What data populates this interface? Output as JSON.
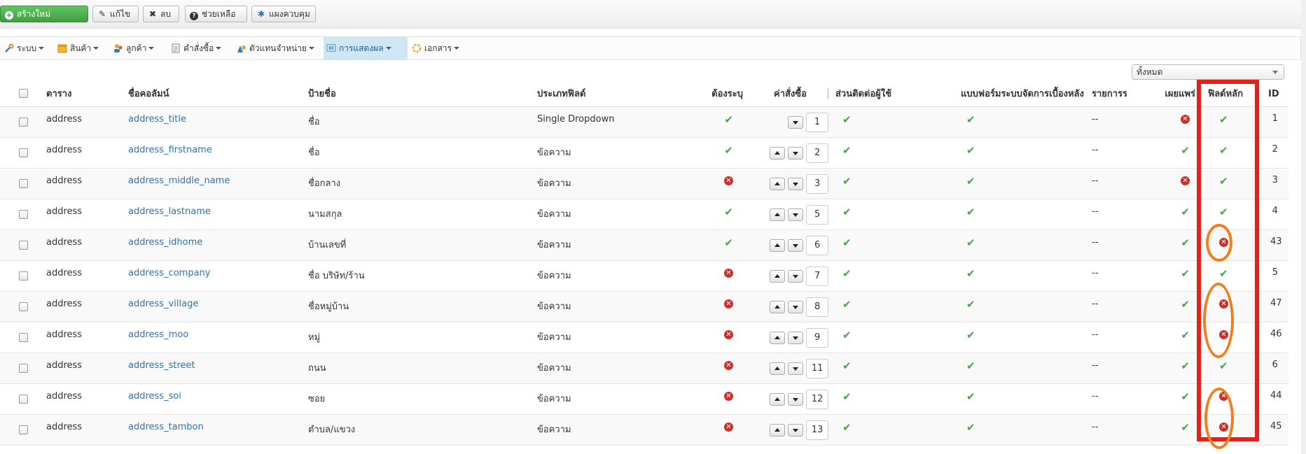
{
  "toolbar": {
    "new_label": "สร้างใหม่",
    "edit_label": "แก้ไข",
    "delete_label": "ลบ",
    "help_label": "ช่วยเหลือ",
    "options_label": "แผงควบคุม"
  },
  "menu": {
    "items": [
      {
        "label": "ระบบ",
        "icon": "tools-icon"
      },
      {
        "label": "สินค้า",
        "icon": "box-icon"
      },
      {
        "label": "ลูกค้า",
        "icon": "users-icon"
      },
      {
        "label": "คำสั่งซื้อ",
        "icon": "order-icon"
      },
      {
        "label": "ตัวแทนจำหน่าย",
        "icon": "vendor-icon"
      },
      {
        "label": "การแสดงผล",
        "icon": "display-icon",
        "active": true
      },
      {
        "label": "เอกสาร",
        "icon": "docs-icon"
      }
    ]
  },
  "filter": {
    "selected": "ทั้งหมด"
  },
  "table": {
    "headers": {
      "table": "ตาราง",
      "column_name": "ชื่อคอลัมน์",
      "label": "ป้ายชื่อ",
      "field_type": "ประเภทฟิลด์",
      "required": "ต้องระบุ",
      "ordering": "ค่าสั่งซื้อ",
      "contact": "ส่วนติดต่อผู้ใช้",
      "admin_form": "แบบฟอร์มระบบจัดการเบื้องหลัง",
      "admin_list": "รายการระบบจัดการเบื้องหลัง",
      "published": "เผยแพร่",
      "core": "ฟิลด์หลัก",
      "id": "ID"
    },
    "rows": [
      {
        "table": "address",
        "column": "address_title",
        "label": "ชื่อ",
        "type": "Single Dropdown",
        "required": true,
        "order": "1",
        "contact": true,
        "admin_form": true,
        "admin_list": "--",
        "published": false,
        "core": true,
        "id": "1",
        "first": true
      },
      {
        "table": "address",
        "column": "address_firstname",
        "label": "ชื่อ",
        "type": "ข้อความ",
        "required": true,
        "order": "2",
        "contact": true,
        "admin_form": true,
        "admin_list": "--",
        "published": true,
        "core": true,
        "id": "2"
      },
      {
        "table": "address",
        "column": "address_middle_name",
        "label": "ชื่อกลาง",
        "type": "ข้อความ",
        "required": false,
        "order": "3",
        "contact": true,
        "admin_form": true,
        "admin_list": "--",
        "published": false,
        "core": true,
        "id": "3"
      },
      {
        "table": "address",
        "column": "address_lastname",
        "label": "นามสกุล",
        "type": "ข้อความ",
        "required": true,
        "order": "5",
        "contact": true,
        "admin_form": true,
        "admin_list": "--",
        "published": true,
        "core": true,
        "id": "4"
      },
      {
        "table": "address",
        "column": "address_idhome",
        "label": "บ้านเลขที่",
        "type": "ข้อความ",
        "required": true,
        "order": "6",
        "contact": true,
        "admin_form": true,
        "admin_list": "--",
        "published": true,
        "core": false,
        "id": "43"
      },
      {
        "table": "address",
        "column": "address_company",
        "label": "ชื่อ บริษัท/ร้าน",
        "type": "ข้อความ",
        "required": false,
        "order": "7",
        "contact": true,
        "admin_form": true,
        "admin_list": "--",
        "published": true,
        "core": true,
        "id": "5"
      },
      {
        "table": "address",
        "column": "address_village",
        "label": "ชื่อหมู่บ้าน",
        "type": "ข้อความ",
        "required": false,
        "order": "8",
        "contact": true,
        "admin_form": true,
        "admin_list": "--",
        "published": true,
        "core": false,
        "id": "47"
      },
      {
        "table": "address",
        "column": "address_moo",
        "label": "หมู่",
        "type": "ข้อความ",
        "required": false,
        "order": "9",
        "contact": true,
        "admin_form": true,
        "admin_list": "--",
        "published": true,
        "core": false,
        "id": "46"
      },
      {
        "table": "address",
        "column": "address_street",
        "label": "ถนน",
        "type": "ข้อความ",
        "required": false,
        "order": "11",
        "contact": true,
        "admin_form": true,
        "admin_list": "--",
        "published": true,
        "core": true,
        "id": "6"
      },
      {
        "table": "address",
        "column": "address_soi",
        "label": "ซอย",
        "type": "ข้อความ",
        "required": false,
        "order": "12",
        "contact": true,
        "admin_form": true,
        "admin_list": "--",
        "published": true,
        "core": false,
        "id": "44"
      },
      {
        "table": "address",
        "column": "address_tambon",
        "label": "ตำบล/แขวง",
        "type": "ข้อความ",
        "required": false,
        "order": "13",
        "contact": true,
        "admin_form": true,
        "admin_list": "--",
        "published": true,
        "core": false,
        "id": "45"
      }
    ]
  },
  "colors": {
    "accent": "#2a73b3",
    "ok": "#46a546",
    "bad": "#c9302c",
    "highlight_box": "#e32119",
    "highlight_oval": "#f07f1d"
  }
}
